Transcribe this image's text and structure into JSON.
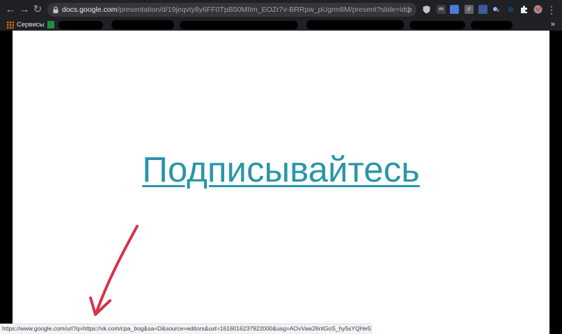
{
  "browser": {
    "url_host": "docs.google.com",
    "url_path": "/presentation/d/19jeqvty8y6FF0TpB50MItm_EOZr7v-BRRpw_pUgrm8M/present?slide=id.p"
  },
  "bookmarks": {
    "apps_label": "Сервисы"
  },
  "slide": {
    "link_text": "Подписывайтесь"
  },
  "status_bar": {
    "hover_url": "https://www.google.com/url?q=https://vk.com/cpa_bog&sa=D&source=editors&ust=1616016237922000&usg=AOvVaw26ntGoS_hy5sYQHe5tU5DG"
  },
  "colors": {
    "link": "#2a96a8",
    "arrow": "#d8334a",
    "chrome": "#202124"
  }
}
